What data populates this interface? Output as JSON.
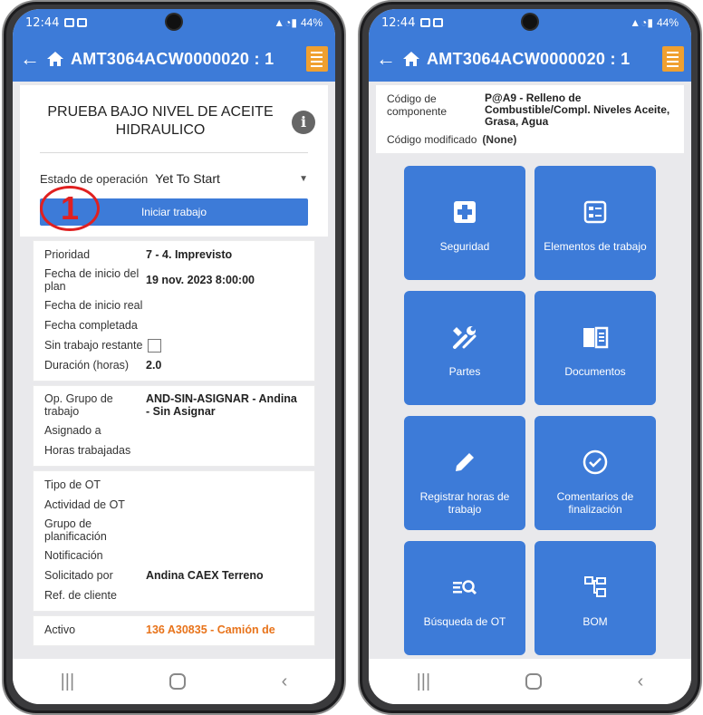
{
  "status_bar": {
    "time": "12:44",
    "battery": "44%"
  },
  "appbar": {
    "title": "AMT3064ACW0000020 : 1"
  },
  "left": {
    "task_title": "PRUEBA BAJO NIVEL DE ACEITE HIDRAULICO",
    "op_state_label": "Estado de operación",
    "op_state_value": "Yet To Start",
    "start_button": "Iniciar trabajo",
    "annotation": "1",
    "section1": [
      {
        "label": "Prioridad",
        "value": "7 - 4. Imprevisto"
      },
      {
        "label": "Fecha de inicio del plan",
        "value": "19 nov. 2023 8:00:00"
      },
      {
        "label": "Fecha de inicio real",
        "value": ""
      },
      {
        "label": "Fecha completada",
        "value": ""
      },
      {
        "label": "Sin trabajo restante",
        "value": ""
      },
      {
        "label": "Duración (horas)",
        "value": "2.0"
      }
    ],
    "section2": [
      {
        "label": "Op. Grupo de trabajo",
        "value": "AND-SIN-ASIGNAR - Andina - Sin Asignar"
      },
      {
        "label": "Asignado a",
        "value": ""
      },
      {
        "label": "Horas trabajadas",
        "value": ""
      }
    ],
    "section3": [
      {
        "label": "Tipo de OT",
        "value": ""
      },
      {
        "label": "Actividad de OT",
        "value": ""
      },
      {
        "label": "Grupo de planificación",
        "value": ""
      },
      {
        "label": "Notificación",
        "value": ""
      },
      {
        "label": "Solicitado por",
        "value": "Andina CAEX Terreno"
      },
      {
        "label": "Ref. de cliente",
        "value": ""
      }
    ],
    "asset": {
      "label": "Activo",
      "value": "136 A30835 - Camión de"
    }
  },
  "right": {
    "component_code_label": "Código de componente",
    "component_code_value": "P@A9 - Relleno de Combustible/Compl. Niveles Aceite, Grasa, Agua",
    "modified_code_label": "Código modificado",
    "modified_code_value": "(None)",
    "tiles": [
      {
        "label": "Seguridad",
        "icon": "medical-plus-icon"
      },
      {
        "label": "Elementos de trabajo",
        "icon": "checklist-icon"
      },
      {
        "label": "Partes",
        "icon": "tools-icon"
      },
      {
        "label": "Documentos",
        "icon": "book-icon"
      },
      {
        "label": "Registrar horas de trabajo",
        "icon": "pencil-icon"
      },
      {
        "label": "Comentarios de finalización",
        "icon": "check-circle-icon"
      },
      {
        "label": "Búsqueda de OT",
        "icon": "list-search-icon"
      },
      {
        "label": "BOM",
        "icon": "hierarchy-icon"
      }
    ]
  },
  "colors": {
    "primary": "#3d7bd8",
    "accent_orange": "#e8731a",
    "annotation_red": "#e02020"
  }
}
